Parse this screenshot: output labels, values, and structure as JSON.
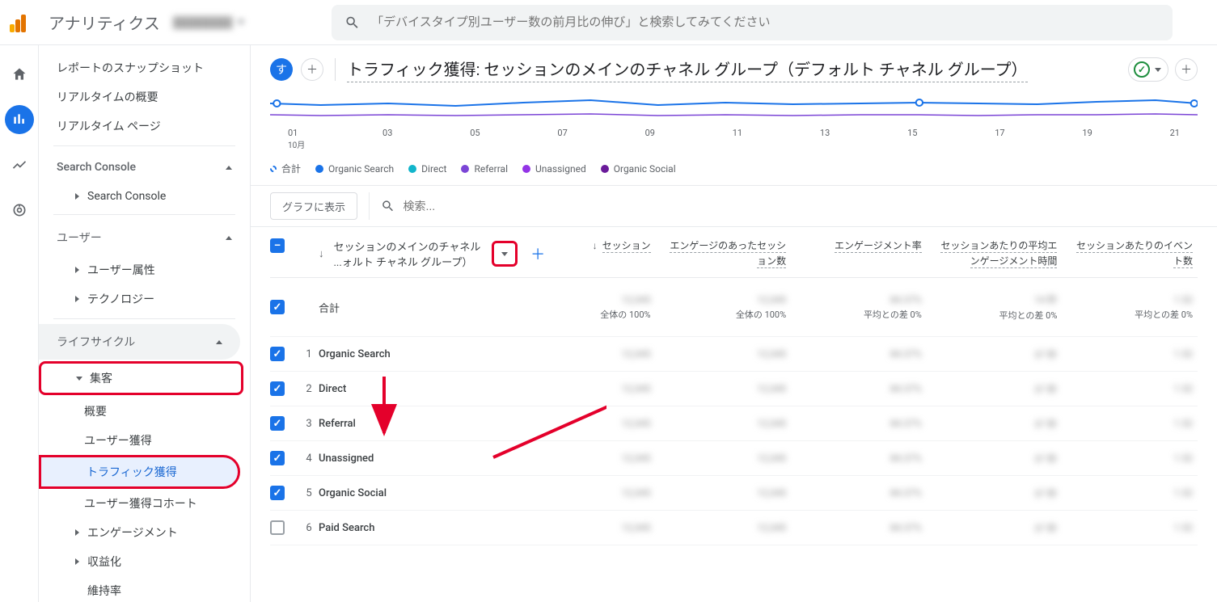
{
  "brand": "アナリティクス",
  "search_placeholder": "「デバイスタイプ別ユーザー数の前月比の伸び」と検索してみてください",
  "sidenav": {
    "snapshot": "レポートのスナップショット",
    "realtime_overview": "リアルタイムの概要",
    "realtime_pages": "リアルタイム ページ",
    "search_console_group": "Search Console",
    "search_console_item": "Search Console",
    "user_group": "ユーザー",
    "user_attr": "ユーザー属性",
    "technology": "テクノロジー",
    "lifecycle_group": "ライフサイクル",
    "acquisition": "集客",
    "overview": "概要",
    "user_acq": "ユーザー獲得",
    "traffic_acq": "トラフィック獲得",
    "user_acq_cohort": "ユーザー獲得コホート",
    "engagement": "エンゲージメント",
    "monetization": "収益化",
    "retention": "維持率"
  },
  "page": {
    "chip": "す",
    "title_prefix": "トラフィック獲得: ",
    "title_dim": "セッションのメインのチャネル グループ（デフォルト チャネル グループ）"
  },
  "chart_data": {
    "type": "line",
    "x_ticks": [
      "01",
      "03",
      "05",
      "07",
      "09",
      "11",
      "13",
      "15",
      "17",
      "19",
      "21"
    ],
    "x_sublabel": "10月",
    "series": [
      {
        "name": "合計",
        "color": "#1a73e8",
        "dashed": true
      },
      {
        "name": "Organic Search",
        "color": "#1a73e8"
      },
      {
        "name": "Direct",
        "color": "#12b5cb"
      },
      {
        "name": "Referral",
        "color": "#7b45d6"
      },
      {
        "name": "Unassigned",
        "color": "#9334e6"
      },
      {
        "name": "Organic Social",
        "color": "#6a1b9a"
      }
    ]
  },
  "toolbar": {
    "show_in_chart": "グラフに表示",
    "search_ph": "検索..."
  },
  "table": {
    "dim_label": "セッションのメインのチャネル ...ォルト チャネル グループ）",
    "metrics": [
      "セッション",
      "エンゲージのあったセッション数",
      "エンゲージメント率",
      "セッションあたりの平均エンゲージメント時間",
      "セッションあたりのイベント数"
    ],
    "total_label": "合計",
    "total_sub": [
      "全体の 100%",
      "全体の 100%",
      "平均との差 0%",
      "平均との差 0%",
      "平均との差 0%"
    ],
    "rows": [
      {
        "idx": "1",
        "name": "Organic Search",
        "checked": true
      },
      {
        "idx": "2",
        "name": "Direct",
        "checked": true
      },
      {
        "idx": "3",
        "name": "Referral",
        "checked": true
      },
      {
        "idx": "4",
        "name": "Unassigned",
        "checked": true
      },
      {
        "idx": "5",
        "name": "Organic Social",
        "checked": true
      },
      {
        "idx": "6",
        "name": "Paid Search",
        "checked": false
      }
    ]
  }
}
